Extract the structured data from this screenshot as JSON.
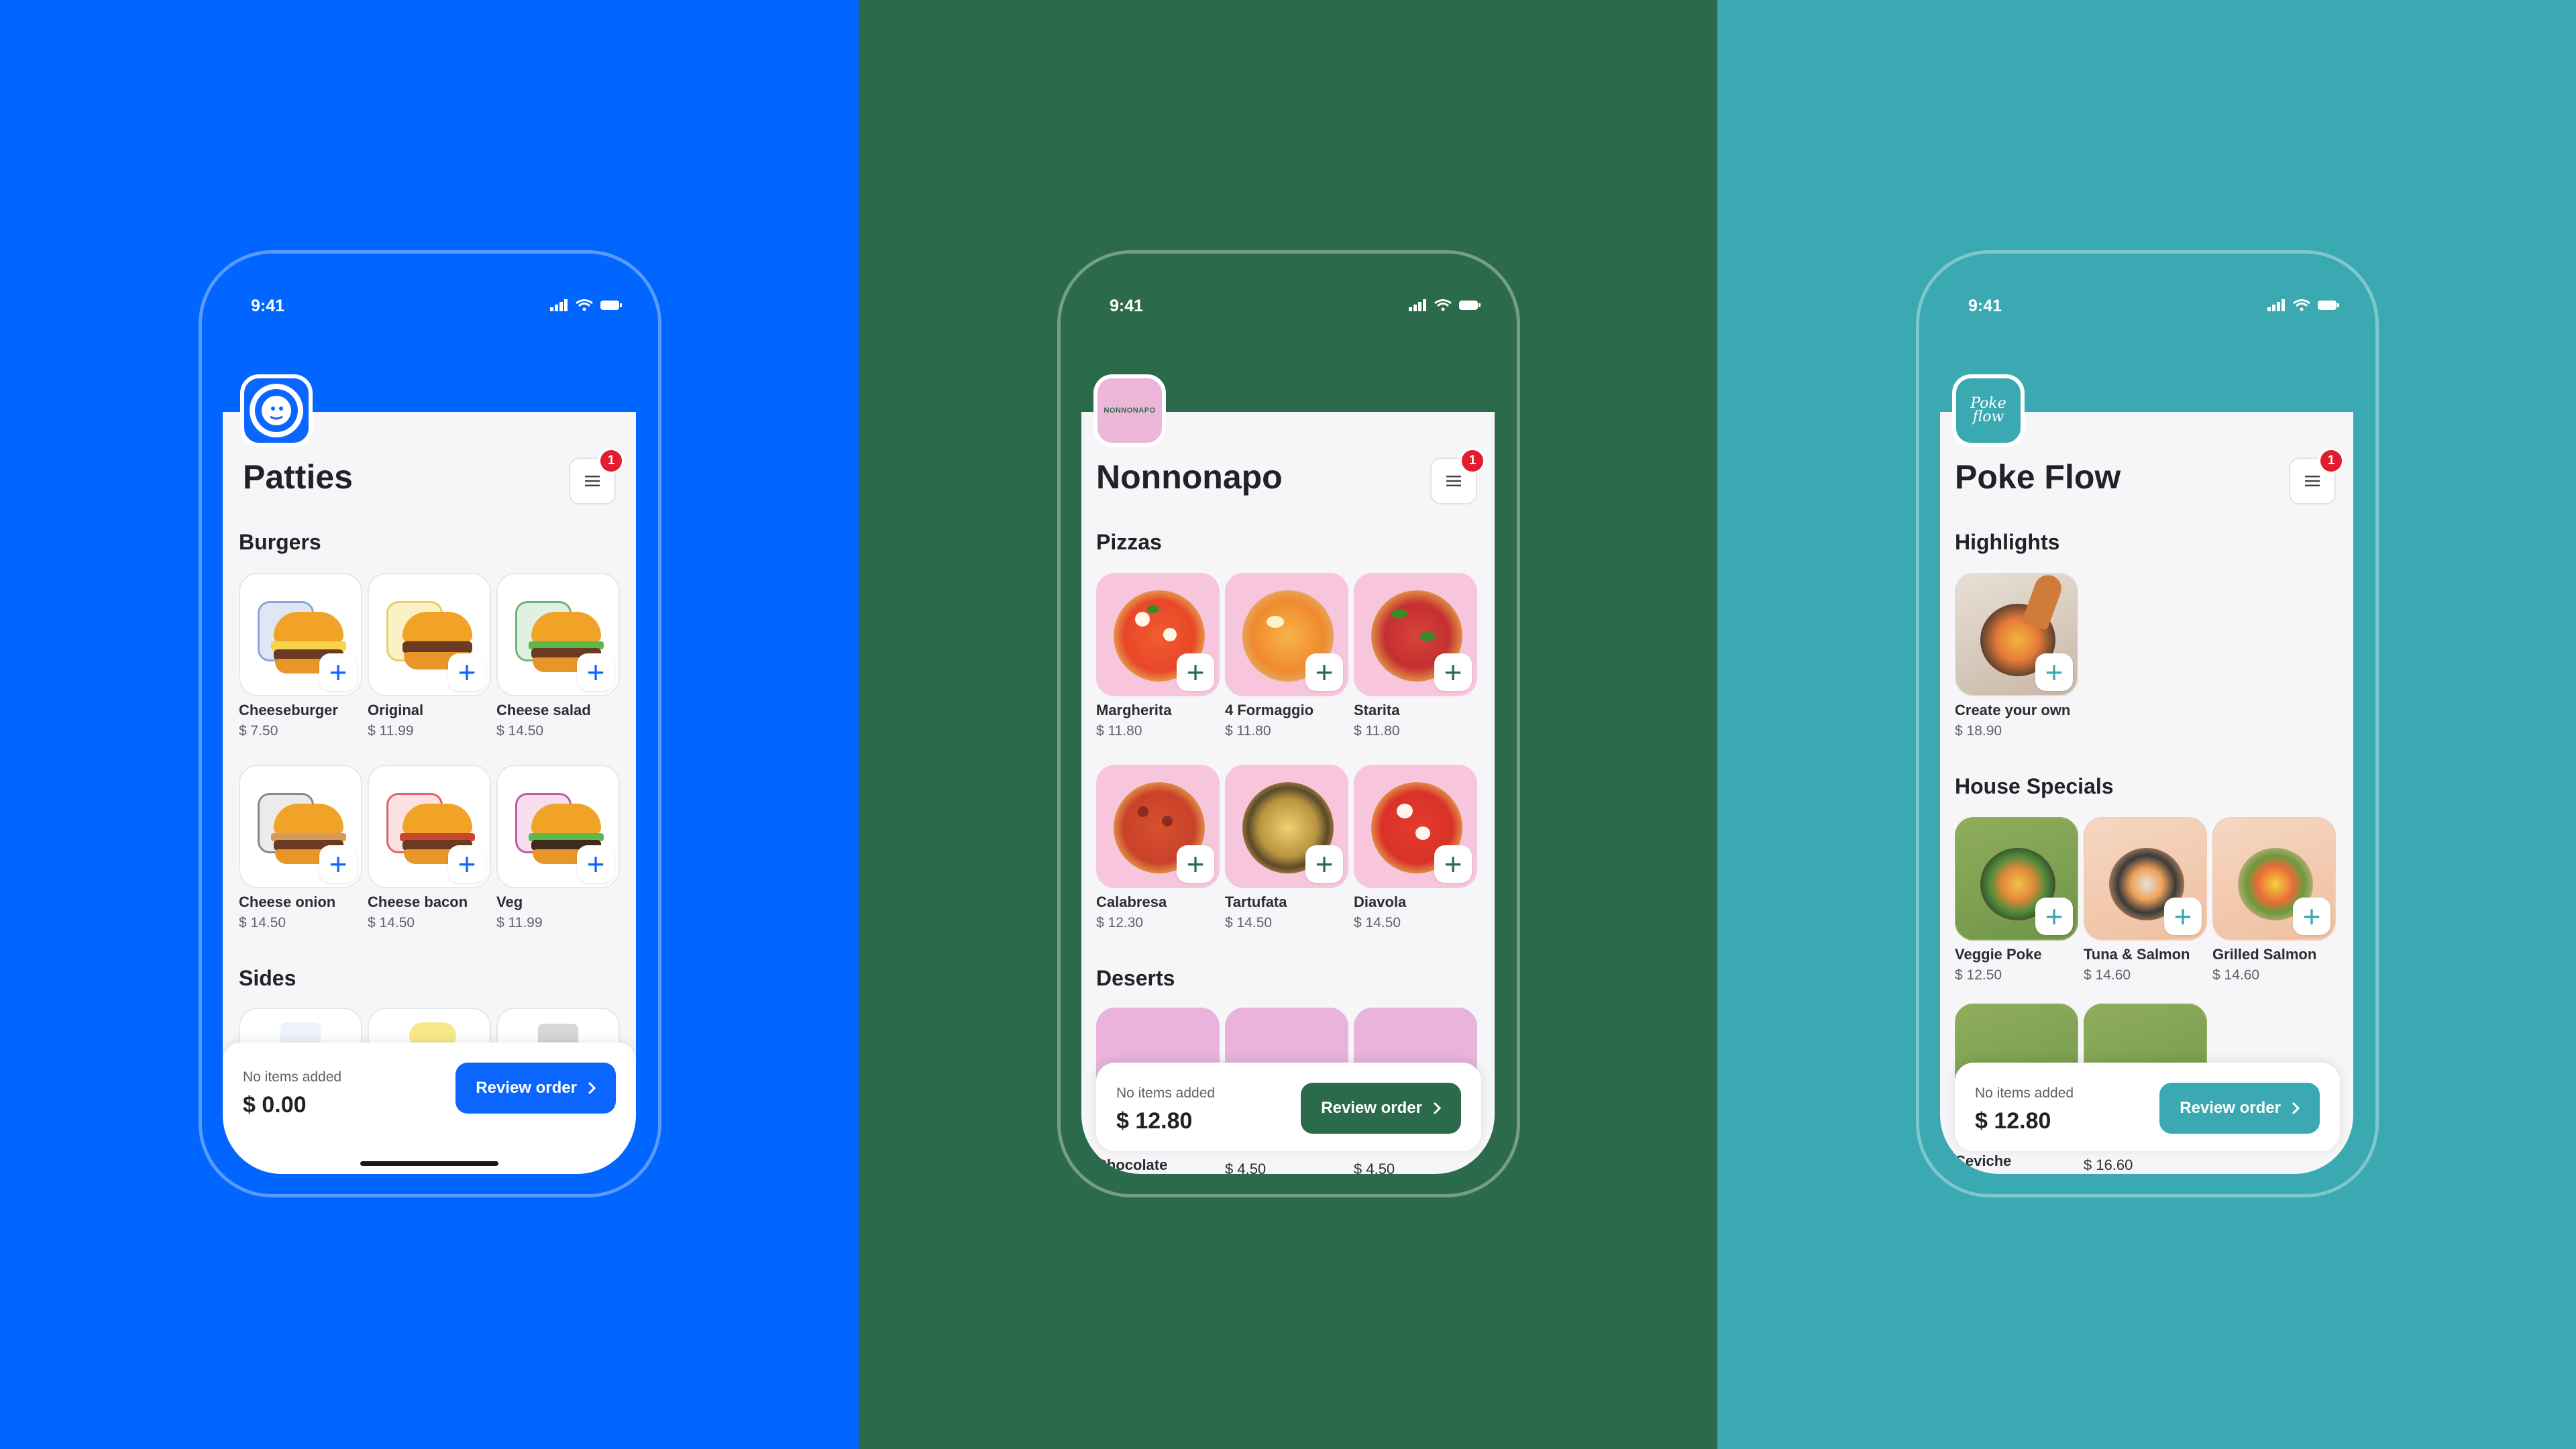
{
  "status": {
    "time": "9:41"
  },
  "panels": [
    {
      "id": "patties",
      "bg": "#0066ff",
      "accent": "#0a66ff",
      "title": "Patties",
      "cart_badge": "1",
      "sections": [
        {
          "title": "Burgers",
          "items": [
            {
              "name": "Cheeseburger",
              "price": "$ 7.50"
            },
            {
              "name": "Original",
              "price": "$ 11.99"
            },
            {
              "name": "Cheese salad",
              "price": "$ 14.50"
            },
            {
              "name": "Cheese onion",
              "price": "$ 14.50"
            },
            {
              "name": "Cheese bacon",
              "price": "$ 14.50"
            },
            {
              "name": "Veg",
              "price": "$ 11.99"
            }
          ]
        },
        {
          "title": "Sides"
        }
      ],
      "bottom": {
        "label": "No items added",
        "amount": "$ 0.00",
        "button": "Review order"
      }
    },
    {
      "id": "nonnonapo",
      "bg": "#2c6a4c",
      "accent": "#2c6a4c",
      "title": "Nonnonapo",
      "logo_text": "NONNONAPO",
      "cart_badge": "1",
      "sections": [
        {
          "title": "Pizzas",
          "items": [
            {
              "name": "Margherita",
              "price": "$ 11.80"
            },
            {
              "name": "4 Formaggio",
              "price": "$ 11.80"
            },
            {
              "name": "Starita",
              "price": "$ 11.80"
            },
            {
              "name": "Calabresa",
              "price": "$ 12.30"
            },
            {
              "name": "Tartufata",
              "price": "$ 14.50"
            },
            {
              "name": "Diavola",
              "price": "$ 14.50"
            }
          ]
        },
        {
          "title": "Deserts",
          "items": [
            {
              "name": "Chocolate",
              "price": ""
            },
            {
              "name": "",
              "price": "$ 4.50"
            },
            {
              "name": "",
              "price": "$ 4.50"
            }
          ]
        }
      ],
      "bottom": {
        "label": "No items added",
        "amount": "$ 12.80",
        "button": "Review order"
      }
    },
    {
      "id": "pokeflow",
      "bg": "#3aa9b1",
      "accent": "#3aa9b1",
      "title": "Poke Flow",
      "logo_text": "Poke flow",
      "cart_badge": "1",
      "sections": [
        {
          "title": "Highlights",
          "items": [
            {
              "name": "Create your own",
              "price": "$ 18.90"
            }
          ]
        },
        {
          "title": "House Specials",
          "items": [
            {
              "name": "Veggie Poke",
              "price": "$ 12.50"
            },
            {
              "name": "Tuna & Salmon",
              "price": "$ 14.60"
            },
            {
              "name": "Grilled Salmon",
              "price": "$ 14.60"
            },
            {
              "name": "Ceviche",
              "price": ""
            },
            {
              "name": "",
              "price": "$ 16.60"
            }
          ]
        }
      ],
      "bottom": {
        "label": "No items added",
        "amount": "$ 12.80",
        "button": "Review order"
      }
    }
  ]
}
